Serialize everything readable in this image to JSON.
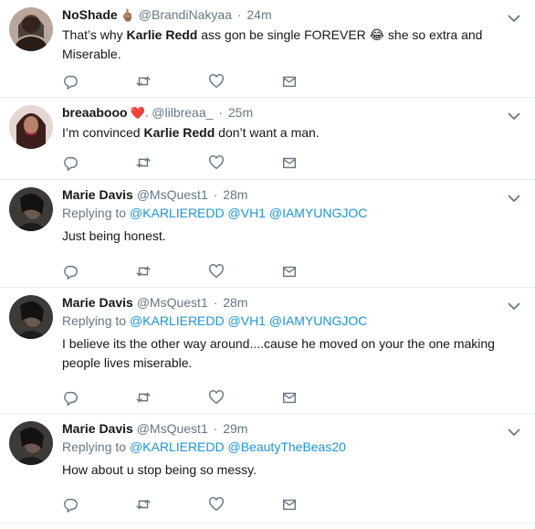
{
  "tweets": [
    {
      "name": "NoShade",
      "emoji": "🖕🏽",
      "handle": "@BrandiNakyaa",
      "time": "24m",
      "text_before": "That’s why ",
      "text_bold": "Karlie Redd",
      "text_after": " ass gon be single FOREVER 😂 she so extra and Miserable."
    },
    {
      "name": "breaabooo",
      "emoji": "❤️.",
      "handle": "@lilbreaa_",
      "time": "25m",
      "text_before": "I’m convinced ",
      "text_bold": "Karlie Redd",
      "text_after": " don’t want a man."
    },
    {
      "name": "Marie Davis",
      "handle": "@MsQuest1",
      "time": "28m",
      "replying_label": "Replying to",
      "mentions": [
        "@KARLIEREDD",
        "@VH1",
        "@IAMYUNGJOC"
      ],
      "text": "Just being honest."
    },
    {
      "name": "Marie Davis",
      "handle": "@MsQuest1",
      "time": "28m",
      "replying_label": "Replying to",
      "mentions": [
        "@KARLIEREDD",
        "@VH1",
        "@IAMYUNGJOC"
      ],
      "text": "I believe its the other way around....cause he moved on your the one making people lives miserable."
    },
    {
      "name": "Marie Davis",
      "handle": "@MsQuest1",
      "time": "29m",
      "replying_label": "Replying to",
      "mentions": [
        "@KARLIEREDD",
        "@BeautyTheBeas20"
      ],
      "text": "How about u stop being so messy."
    }
  ],
  "separator": "·",
  "icons": {
    "reply": "reply-icon",
    "retweet": "retweet-icon",
    "like": "heart-icon",
    "dm": "envelope-icon",
    "caret": "chevron-down-icon"
  },
  "colors": {
    "link": "#1b95e0",
    "secondary": "#657786",
    "divider": "#e6ecf0"
  }
}
